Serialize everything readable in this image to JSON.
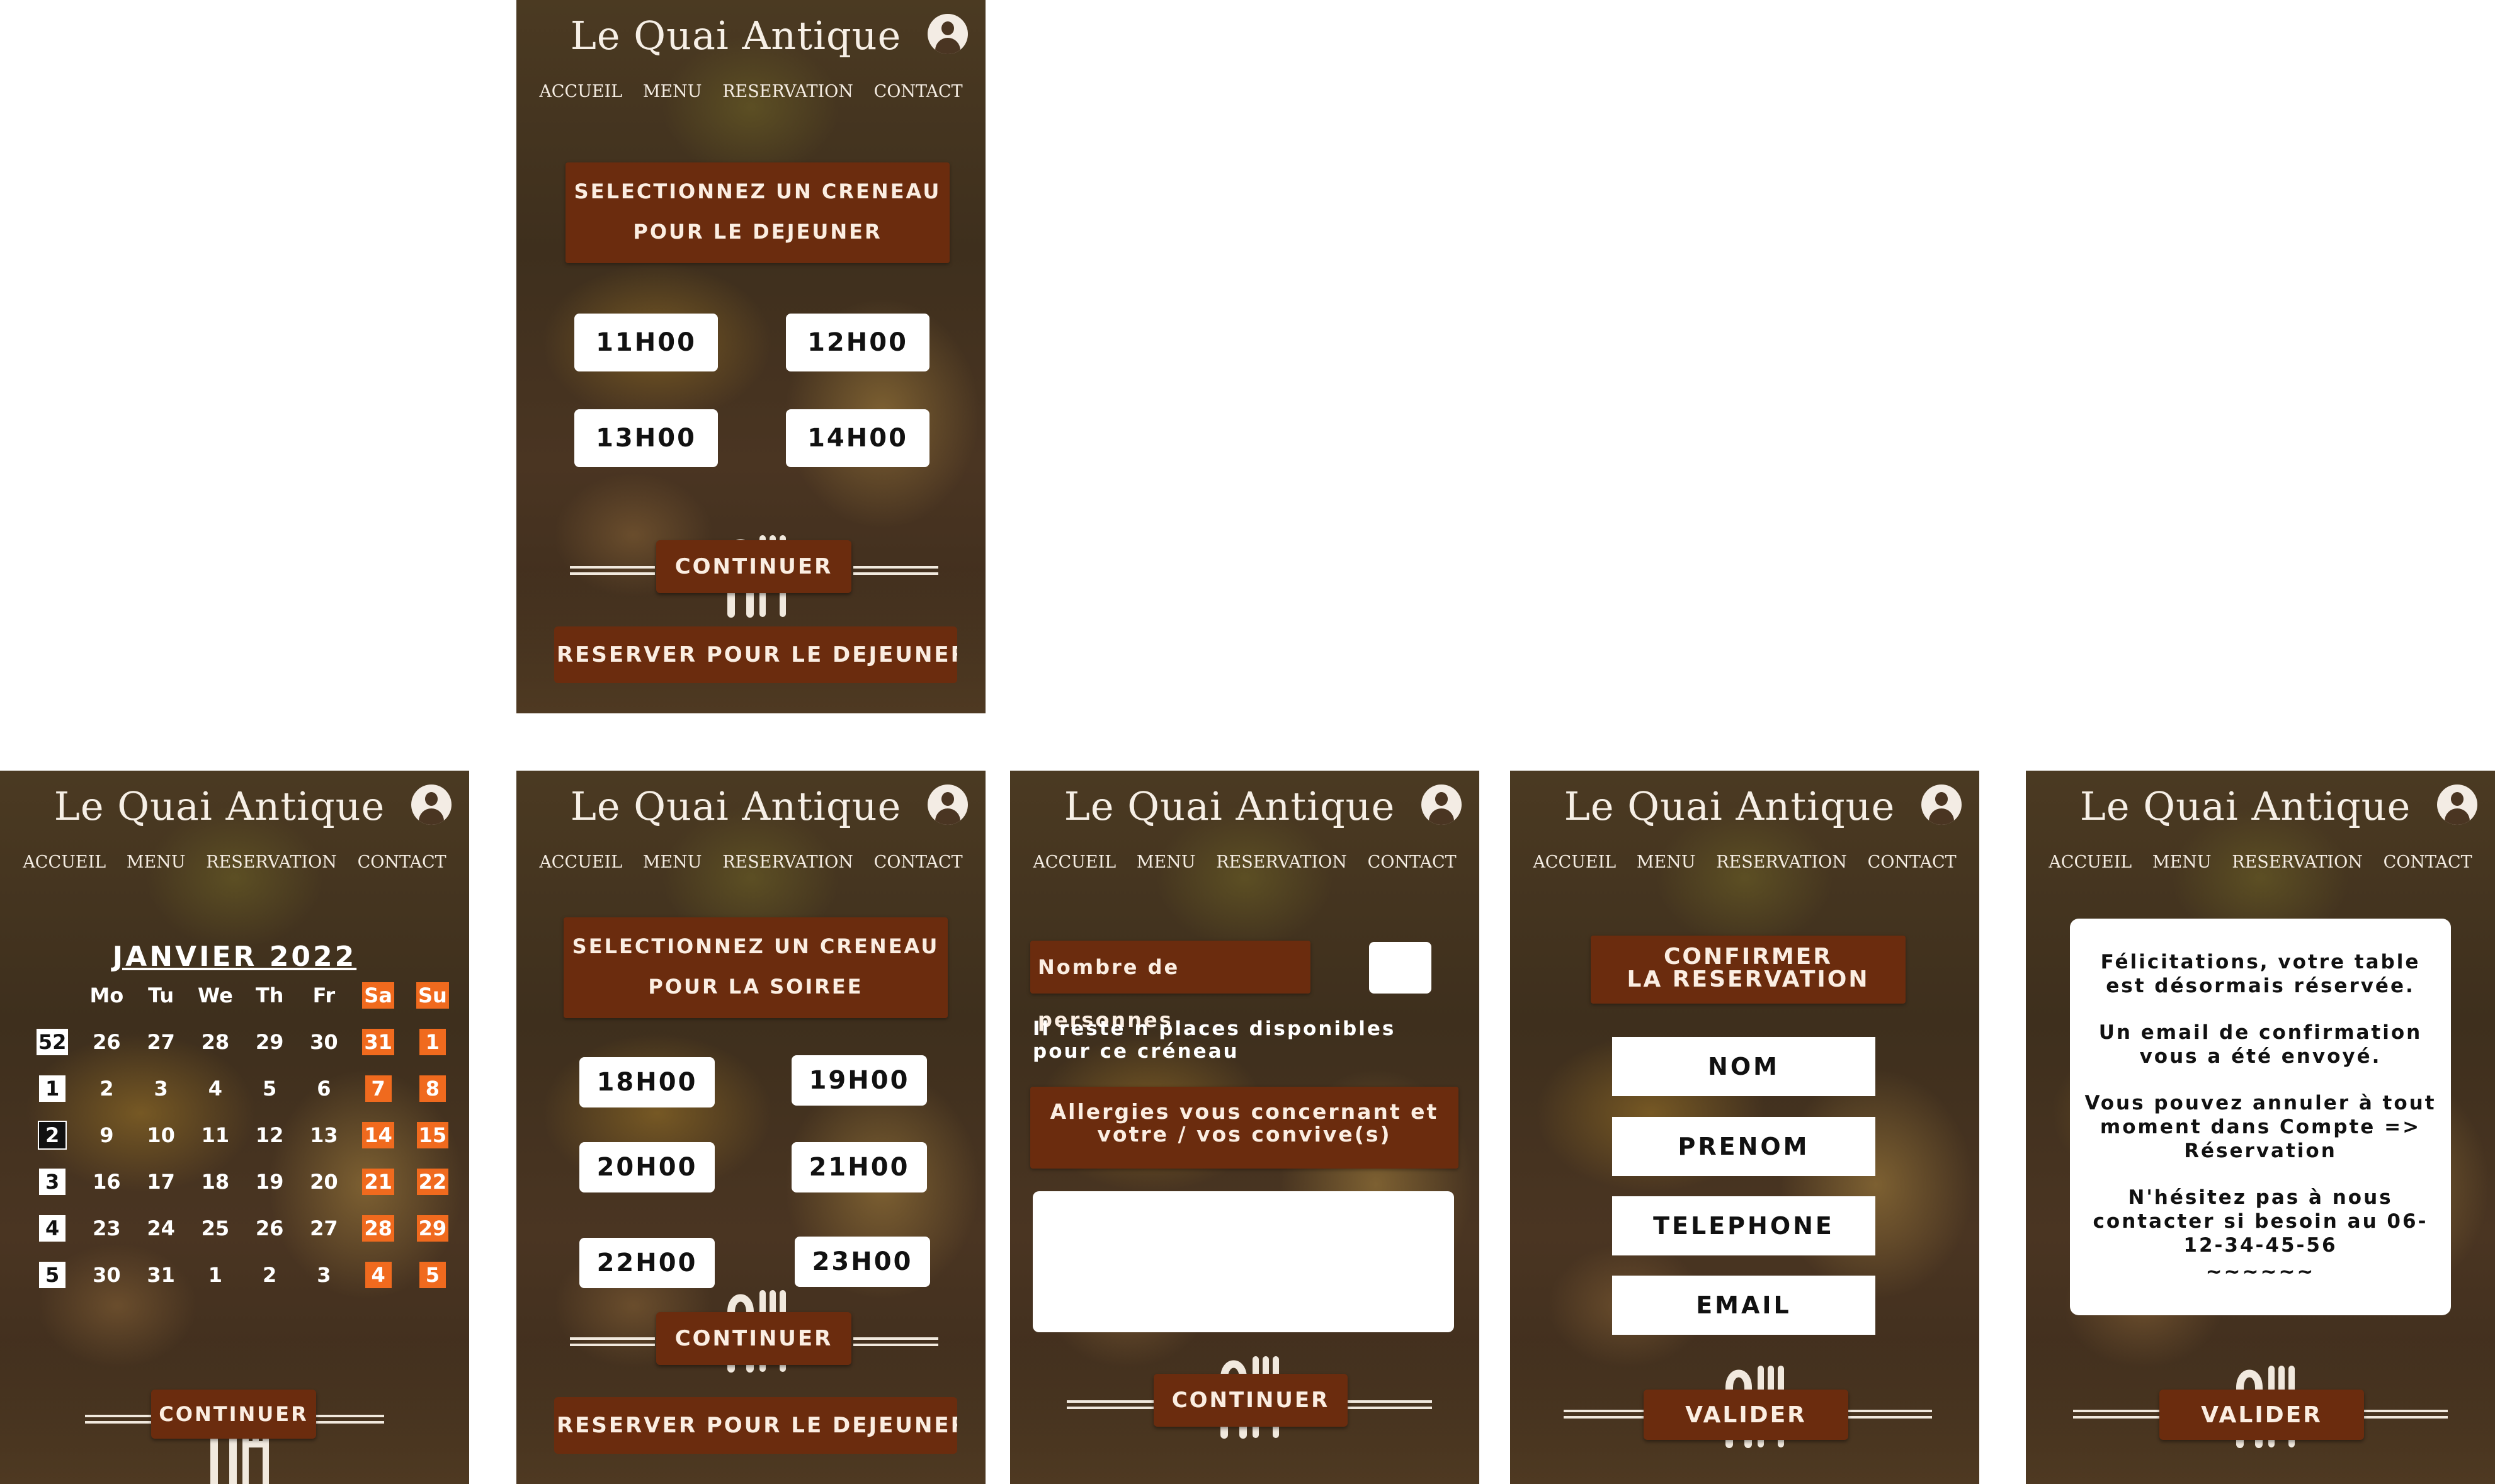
{
  "app_title": "Le Quai Antique",
  "nav": [
    "ACCUEIL",
    "MENU",
    "RESERVATION",
    "CONTACT"
  ],
  "lunch": {
    "heading_line1": "SELECTIONNEZ UN CRENEAU",
    "heading_line2": "POUR LE DEJEUNER",
    "slots": [
      "11H00",
      "12H00",
      "13H00",
      "14H00"
    ],
    "continue_label": "CONTINUER",
    "reserve_label": "RESERVER POUR LE DEJEUNER"
  },
  "calendar": {
    "month_title": "JANVIER 2022",
    "weekdays": [
      "Mo",
      "Tu",
      "We",
      "Th",
      "Fr",
      "Sa",
      "Su"
    ],
    "weeks": [
      {
        "num": "52",
        "days": [
          "26",
          "27",
          "28",
          "29",
          "30",
          "31",
          "1"
        ]
      },
      {
        "num": "1",
        "days": [
          "2",
          "3",
          "4",
          "5",
          "6",
          "7",
          "8"
        ]
      },
      {
        "num": "2",
        "days": [
          "9",
          "10",
          "11",
          "12",
          "13",
          "14",
          "15"
        ]
      },
      {
        "num": "3",
        "days": [
          "16",
          "17",
          "18",
          "19",
          "20",
          "21",
          "22"
        ]
      },
      {
        "num": "4",
        "days": [
          "23",
          "24",
          "25",
          "26",
          "27",
          "28",
          "29"
        ]
      },
      {
        "num": "5",
        "days": [
          "30",
          "31",
          "1",
          "2",
          "3",
          "4",
          "5"
        ]
      }
    ],
    "continue_label": "CONTINUER"
  },
  "dinner": {
    "heading_line1": "SELECTIONNEZ UN CRENEAU",
    "heading_line2": "POUR LA SOIREE",
    "slots": [
      "18H00",
      "19H00",
      "20H00",
      "21H00",
      "22H00",
      "23H00"
    ],
    "continue_label": "CONTINUER",
    "reserve_label": "RESERVER POUR LE DEJEUNER"
  },
  "guests": {
    "people_label": "Nombre de personnes",
    "people_value": "",
    "availability_text": "Il reste n places disponibles pour ce créneau",
    "allergy_label_line1": "Allergies vous concernant et",
    "allergy_label_line2": "votre / vos convive(s)",
    "allergy_value": "",
    "continue_label": "CONTINUER"
  },
  "confirm": {
    "heading_line1": "CONFIRMER",
    "heading_line2": "LA RESERVATION",
    "fields": [
      "NOM",
      "PRENOM",
      "TELEPHONE",
      "EMAIL"
    ],
    "submit_label": "VALIDER"
  },
  "success": {
    "message_1": "Félicitations, votre table est désormais réservée.",
    "message_2": "Un email de confirmation vous a été envoyé.",
    "message_3": "Vous pouvez annuler à tout moment dans Compte => Réservation",
    "message_4": "N'hésitez pas à nous contacter si besoin au 06-12-34-45-56",
    "message_5": "~~~~~~",
    "submit_label": "VALIDER"
  },
  "colors": {
    "brand_brown": "#6b2c0e",
    "weekend_orange": "#f06a1e",
    "white": "#ffffff"
  }
}
